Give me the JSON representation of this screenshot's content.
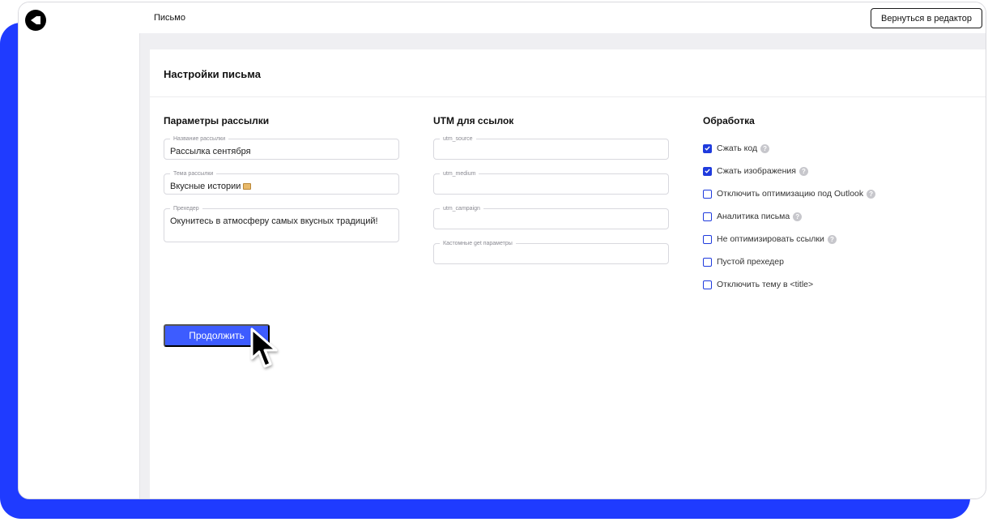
{
  "topbar": {
    "title": "Письмо",
    "back_button_label": "Вернуться в редактор"
  },
  "settings": {
    "title": "Настройки письма",
    "mailing": {
      "heading": "Параметры рассылки",
      "fields": [
        {
          "label": "Название рассылки",
          "value": "Рассылка сентября"
        },
        {
          "label": "Тема рассылки",
          "value": "Вкусные истории"
        },
        {
          "label": "Прехедер",
          "value": "Окунитесь в атмосферу самых вкусных традиций!"
        }
      ]
    },
    "utm": {
      "heading": "UTM для ссылок",
      "fields": [
        {
          "label": "utm_source",
          "value": ""
        },
        {
          "label": "utm_medium",
          "value": ""
        },
        {
          "label": "utm_campaign",
          "value": ""
        },
        {
          "label": "Кастомные get параметры",
          "value": ""
        }
      ]
    },
    "processing": {
      "heading": "Обработка",
      "options": [
        {
          "label": "Сжать код",
          "checked": true,
          "help": true
        },
        {
          "label": "Сжать изображения",
          "checked": true,
          "help": true
        },
        {
          "label": "Отключить оптимизацию под Outlook",
          "checked": false,
          "help": true
        },
        {
          "label": "Аналитика письма",
          "checked": false,
          "help": true
        },
        {
          "label": "Не оптимизировать ссылки",
          "checked": false,
          "help": true
        },
        {
          "label": "Пустой прехедер",
          "checked": false,
          "help": false
        },
        {
          "label": "Отключить тему в <title>",
          "checked": false,
          "help": false
        }
      ]
    },
    "continue_label": "Продолжить"
  },
  "colors": {
    "accent": "#3d5cff",
    "backdrop": "#1f3bff",
    "checkbox": "#1f3bdd"
  },
  "icons": {
    "logo": "brand-logo-icon",
    "help": "help-icon",
    "checkbox_checked": "checkmark-icon",
    "cursor": "mouse-pointer-icon"
  }
}
